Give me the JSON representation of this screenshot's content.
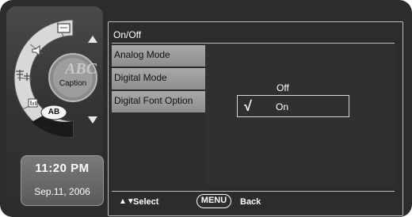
{
  "side_panel": {
    "dial_icons": [
      "screen-icon",
      "speaker-icon",
      "antenna-icon",
      "equalizer-icon"
    ],
    "caption_button_label": "Caption",
    "ab_button_label": "AB",
    "up_arrow": "up-arrow-icon",
    "down_arrow": "down-arrow-icon"
  },
  "clock": {
    "time": "11:20 PM",
    "date": "Sep.11, 2006"
  },
  "osd": {
    "header_label": "On/Off",
    "menu_items": [
      {
        "label": "Analog Mode"
      },
      {
        "label": "Digital Mode"
      },
      {
        "label": "Digital Font Option"
      }
    ],
    "options": {
      "off_label": "Off",
      "on_label": "On",
      "selected": "On",
      "check_glyph": "√"
    },
    "footer": {
      "arrows": "▲▼",
      "select_label": "Select",
      "menu_label": "MENU",
      "back_label": "Back"
    }
  }
}
